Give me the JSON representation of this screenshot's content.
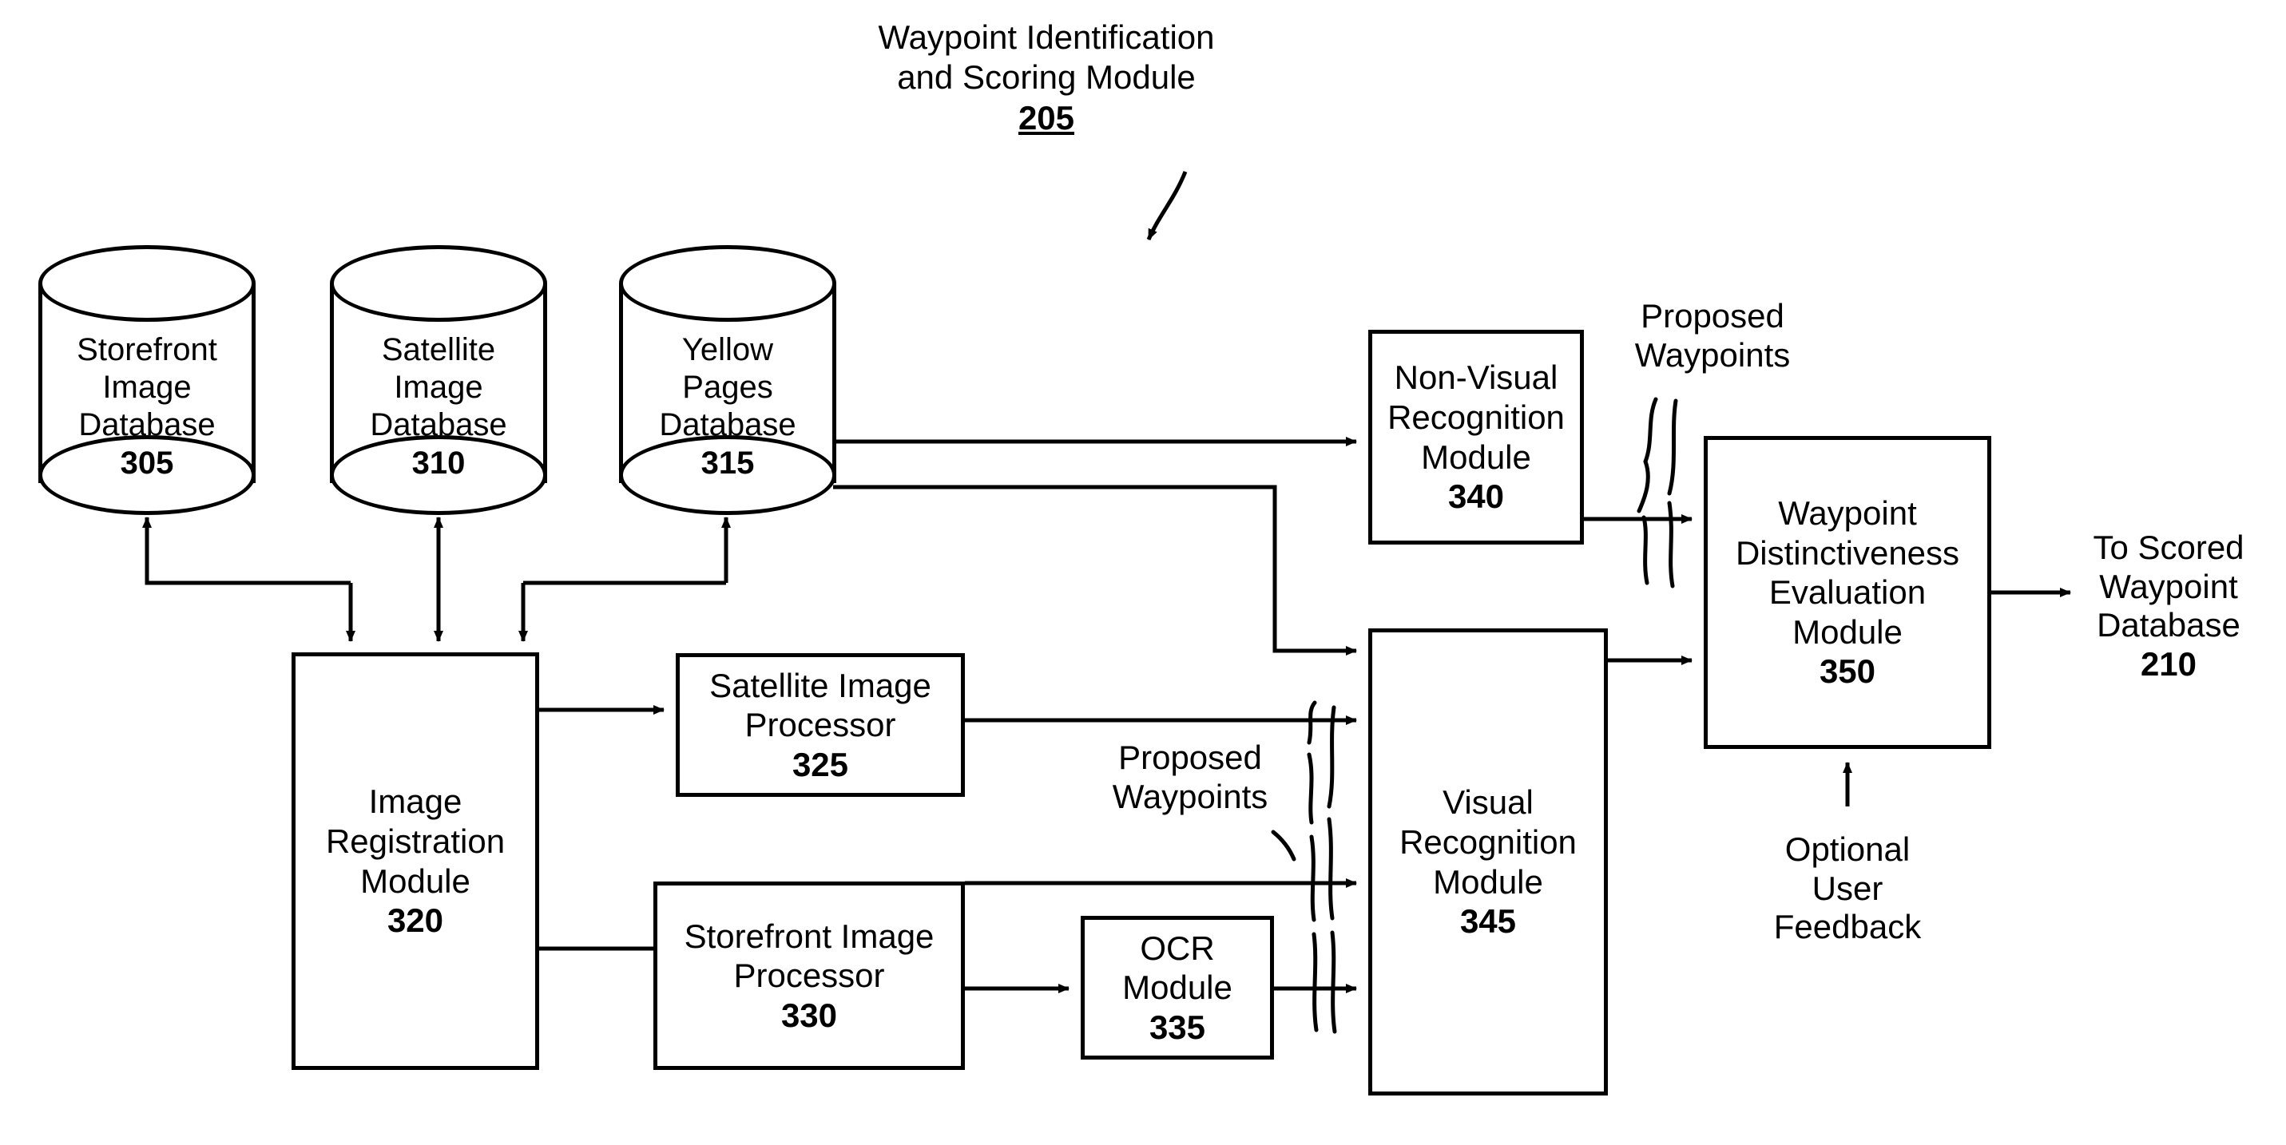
{
  "figure": {
    "title_line1": "Waypoint Identification",
    "title_line2": "and Scoring Module",
    "title_ref": "205"
  },
  "databases": [
    {
      "name": "storefront-image-database",
      "line1": "Storefront",
      "line2": "Image",
      "line3": "Database",
      "ref": "305"
    },
    {
      "name": "satellite-image-database",
      "line1": "Satellite",
      "line2": "Image",
      "line3": "Database",
      "ref": "310"
    },
    {
      "name": "yellow-pages-database",
      "line1": "Yellow",
      "line2": "Pages",
      "line3": "Database",
      "ref": "315"
    }
  ],
  "modules": {
    "image_registration": {
      "line1": "Image",
      "line2": "Registration",
      "line3": "Module",
      "ref": "320"
    },
    "satellite_processor": {
      "line1": "Satellite Image",
      "line2": "Processor",
      "ref": "325"
    },
    "storefront_processor": {
      "line1": "Storefront Image",
      "line2": "Processor",
      "ref": "330"
    },
    "ocr": {
      "line1": "OCR",
      "line2": "Module",
      "ref": "335"
    },
    "non_visual_recognition": {
      "line1": "Non-Visual",
      "line2": "Recognition",
      "line3": "Module",
      "ref": "340"
    },
    "visual_recognition": {
      "line1": "Visual",
      "line2": "Recognition",
      "line3": "Module",
      "ref": "345"
    },
    "waypoint_distinctiveness": {
      "line1": "Waypoint",
      "line2": "Distinctiveness",
      "line3": "Evaluation",
      "line4": "Module",
      "ref": "350"
    }
  },
  "annotations": {
    "proposed_waypoints_upper_l1": "Proposed",
    "proposed_waypoints_upper_l2": "Waypoints",
    "proposed_waypoints_lower_l1": "Proposed",
    "proposed_waypoints_lower_l2": "Waypoints",
    "optional_feedback_l1": "Optional",
    "optional_feedback_l2": "User",
    "optional_feedback_l3": "Feedback",
    "output_l1": "To Scored",
    "output_l2": "Waypoint",
    "output_l3": "Database",
    "output_ref": "210"
  },
  "style": {
    "stroke": "#000000",
    "background": "#ffffff"
  }
}
